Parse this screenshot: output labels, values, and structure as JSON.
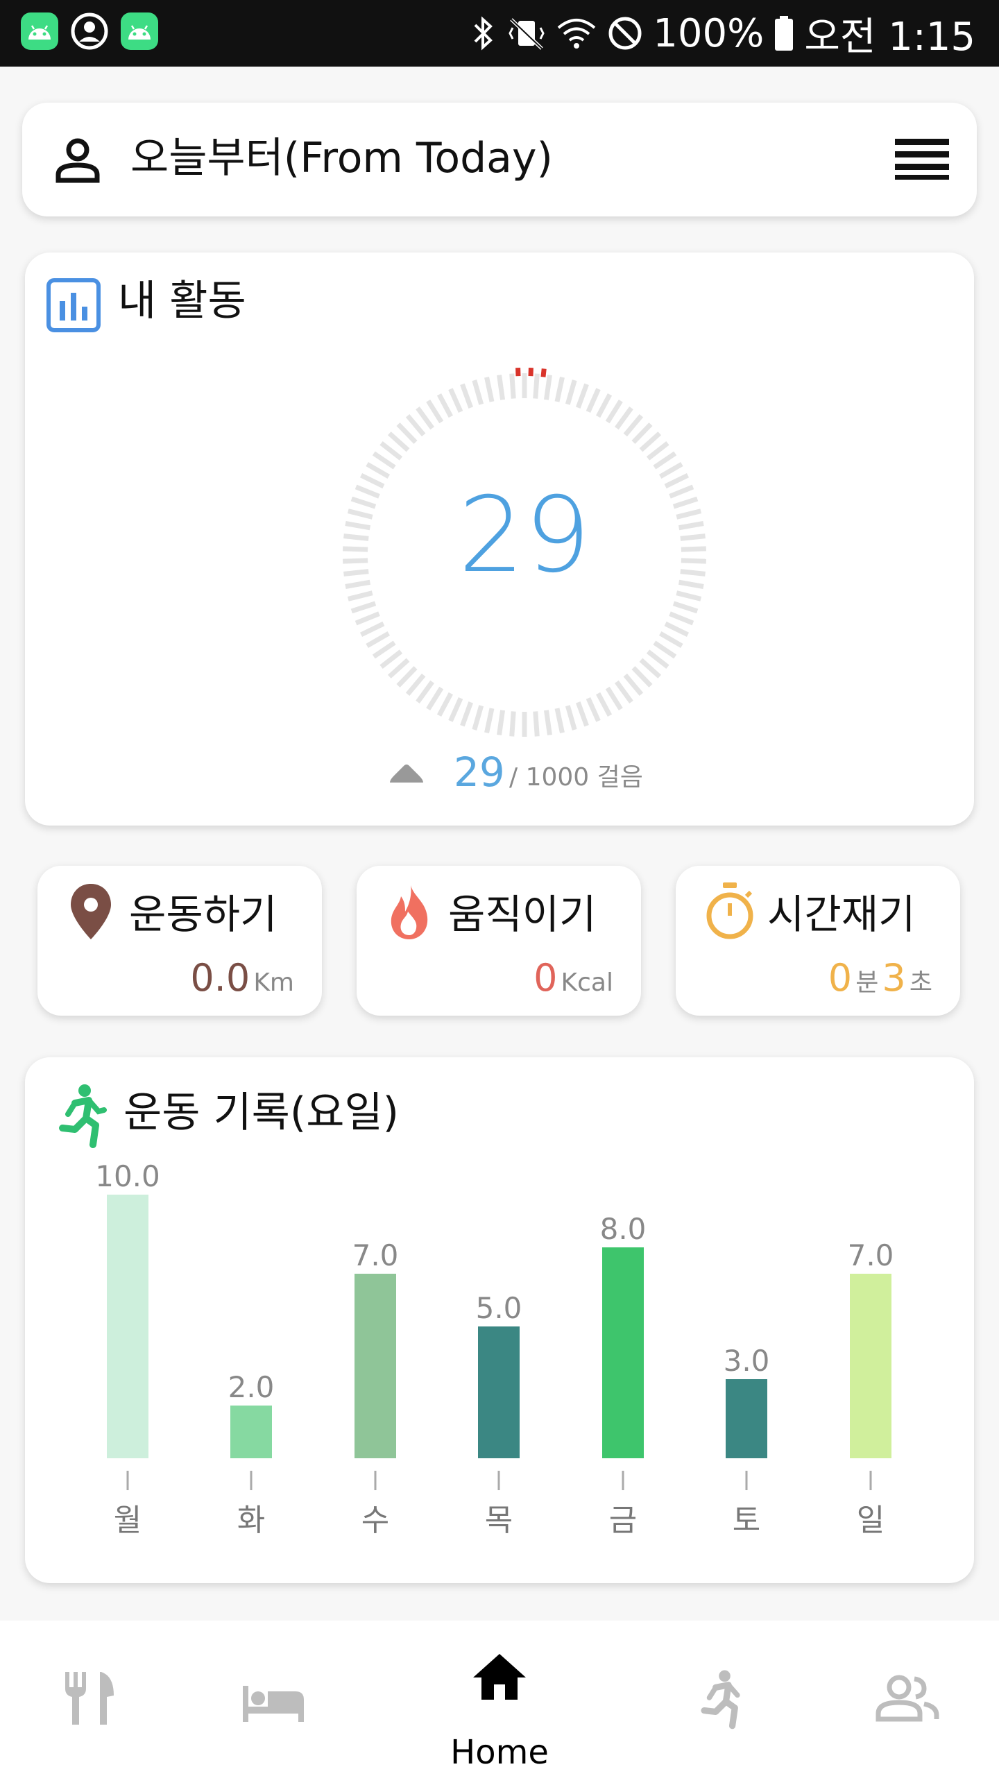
{
  "status_bar": {
    "battery": "100%",
    "time": "오전 1:15",
    "icons": [
      "android-icon",
      "profile-icon",
      "android-icon",
      "bluetooth-icon",
      "vibrate-mute-icon",
      "wifi-icon",
      "do-not-disturb-icon",
      "battery-icon"
    ]
  },
  "header": {
    "title": "오늘부터(From Today)",
    "icons": [
      "user-icon",
      "menu-icon"
    ]
  },
  "activity": {
    "title": "내 활동",
    "icon": "bar-chart-icon",
    "steps": "29",
    "steps_current": "29",
    "steps_goal": "/ 1000 걸음",
    "goal_progress": 0.029,
    "colors": {
      "accent": "#4ea1e0",
      "ring": "#e4e4e4",
      "marker": "#d9342b"
    }
  },
  "stats": [
    {
      "label": "운동하기",
      "icon": "location-pin-icon",
      "value": "0.0",
      "unit": "Km",
      "color": "#7a4e45"
    },
    {
      "label": "움직이기",
      "icon": "flame-icon",
      "value": "0",
      "unit": "Kcal",
      "color": "#e0645a"
    },
    {
      "label": "시간재기",
      "icon": "stopwatch-icon",
      "minutes": "0",
      "minutes_unit": "분",
      "seconds": "3",
      "seconds_unit": "초",
      "color": "#f0b24a"
    }
  ],
  "record": {
    "title": "운동 기록(요일)",
    "icon": "running-icon"
  },
  "chart_data": {
    "type": "bar",
    "categories": [
      "월",
      "화",
      "수",
      "목",
      "금",
      "토",
      "일"
    ],
    "values": [
      10.0,
      2.0,
      7.0,
      5.0,
      8.0,
      3.0,
      7.0
    ],
    "value_labels": [
      "10.0",
      "2.0",
      "7.0",
      "5.0",
      "8.0",
      "3.0",
      "7.0"
    ],
    "colors": [
      "#cdefdc",
      "#86d9a1",
      "#8fc598",
      "#3b8783",
      "#3ec56c",
      "#3b8783",
      "#d0ef9c"
    ],
    "ylim": [
      0,
      10
    ],
    "grid": false,
    "title": "운동 기록(요일)"
  },
  "bottom_nav": {
    "items": [
      {
        "name": "meal",
        "icon": "restaurant-icon"
      },
      {
        "name": "sleep",
        "icon": "bed-icon"
      },
      {
        "name": "home",
        "icon": "home-icon",
        "label": "Home",
        "active": true
      },
      {
        "name": "exercise",
        "icon": "running-icon"
      },
      {
        "name": "friends",
        "icon": "people-icon"
      }
    ],
    "active_color": "#000000",
    "inactive_color": "#bdbdbd"
  }
}
